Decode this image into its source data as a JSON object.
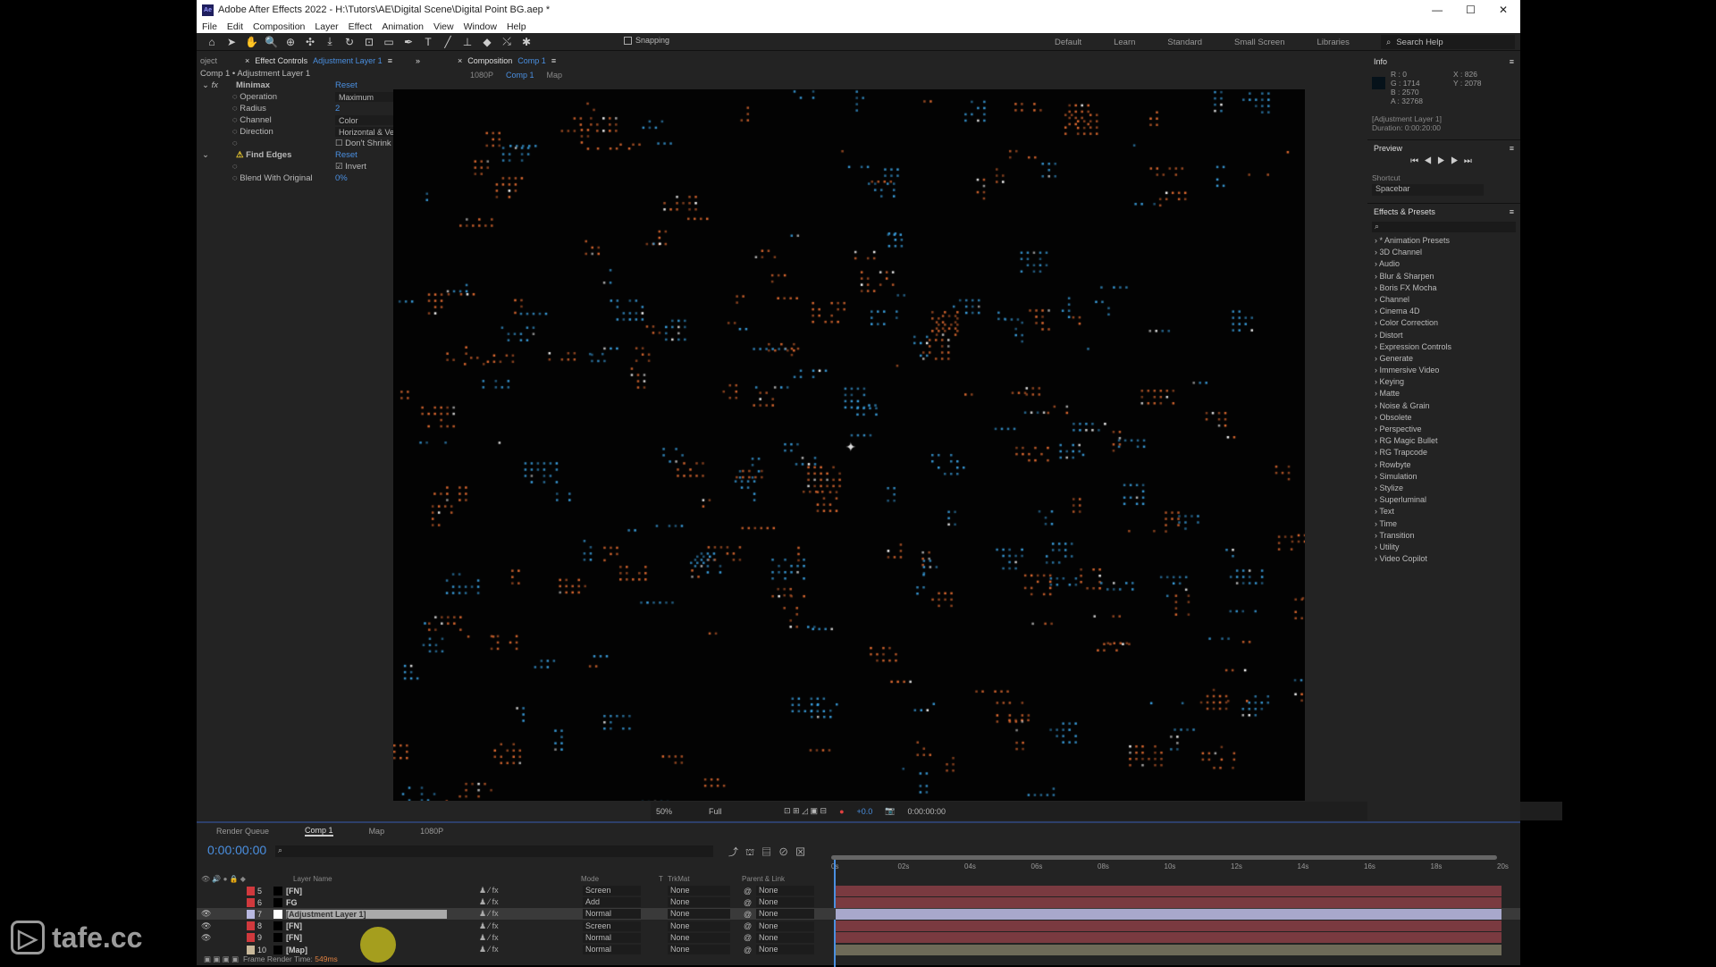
{
  "window": {
    "title": "Adobe After Effects 2022 - H:\\Tutors\\AE\\Digital Scene\\Digital Point BG.aep *",
    "app_icon": "Ae",
    "controls": [
      "—",
      "☐",
      "✕"
    ]
  },
  "menu": [
    "File",
    "Edit",
    "Composition",
    "Layer",
    "Effect",
    "Animation",
    "View",
    "Window",
    "Help"
  ],
  "toolbar": {
    "tools": [
      "⌂",
      "➤",
      "✋",
      "🔍",
      "⊕",
      "✣",
      "⤓",
      "↻",
      "⊡",
      "▭",
      "✒",
      "T",
      "╱",
      "⊥",
      "◆",
      "⤯",
      "✱"
    ],
    "snapping": "Snapping"
  },
  "workspaces": [
    "Default",
    "Learn",
    "Standard",
    "Small Screen",
    "Libraries"
  ],
  "search_help": "Search Help",
  "effect_controls": {
    "project_tab": "oject",
    "tab": "Effect Controls",
    "layer": "Adjustment Layer 1",
    "breadcrumb": "Comp 1 • Adjustment Layer 1",
    "minimax": {
      "name": "Minimax",
      "reset": "Reset",
      "operation_label": "Operation",
      "operation": "Maximum",
      "radius_label": "Radius",
      "radius": "2",
      "channel_label": "Channel",
      "channel": "Color",
      "direction_label": "Direction",
      "direction": "Horizontal & Vertical",
      "dont_shrink": "Don't Shrink Edges",
      "dont_shrink_checked": false
    },
    "find_edges": {
      "name": "Find Edges",
      "reset": "Reset",
      "invert": "Invert",
      "invert_checked": true,
      "blend_label": "Blend With Original",
      "blend": "0%"
    }
  },
  "composition": {
    "tab": "Composition",
    "comp": "Comp 1",
    "crumbs": [
      "1080P",
      "Comp 1",
      "Map"
    ],
    "zoom": "50%",
    "resolution": "Full",
    "exposure": "+0.0",
    "timecode": "0:00:00:00"
  },
  "info": {
    "title": "Info",
    "r": "R : 0",
    "g": "G : 1714",
    "b": "B : 2570",
    "a": "A : 32768",
    "x": "X : 826",
    "y": "Y : 2078",
    "layer": "[Adjustment Layer 1]",
    "duration": "Duration: 0:00:20:00"
  },
  "preview": {
    "title": "Preview",
    "shortcut_label": "Shortcut",
    "shortcut": "Spacebar"
  },
  "effects_presets": {
    "title": "Effects & Presets",
    "items": [
      "* Animation Presets",
      "3D Channel",
      "Audio",
      "Blur & Sharpen",
      "Boris FX Mocha",
      "Channel",
      "Cinema 4D",
      "Color Correction",
      "Distort",
      "Expression Controls",
      "Generate",
      "Immersive Video",
      "Keying",
      "Matte",
      "Noise & Grain",
      "Obsolete",
      "Perspective",
      "RG Magic Bullet",
      "RG Trapcode",
      "Rowbyte",
      "Simulation",
      "Stylize",
      "Superluminal",
      "Text",
      "Time",
      "Transition",
      "Utility",
      "Video Copilot"
    ]
  },
  "timeline": {
    "tabs": [
      "Render Queue",
      "Comp 1",
      "Map",
      "1080P"
    ],
    "timecode": "0:00:00:00",
    "columns": {
      "layer_name": "Layer Name",
      "mode": "Mode",
      "t": "T",
      "trkmat": "TrkMat",
      "parent": "Parent & Link"
    },
    "ruler": [
      "0s",
      "02s",
      "04s",
      "06s",
      "08s",
      "10s",
      "12s",
      "14s",
      "16s",
      "18s",
      "20s"
    ],
    "layers": [
      {
        "num": "5",
        "name": "[FN]",
        "label_color": "#d0393d",
        "mode": "Screen",
        "trkmat": "None",
        "parent": "None",
        "visible": false,
        "bar": "#7a3a40"
      },
      {
        "num": "6",
        "name": "FG",
        "label_color": "#d0393d",
        "mode": "Add",
        "trkmat": "None",
        "parent": "None",
        "visible": false,
        "bar": "#7a3a40"
      },
      {
        "num": "7",
        "name": "[Adjustment Layer 1]",
        "label_color": "#b8b8e0",
        "mode": "Normal",
        "trkmat": "None",
        "parent": "None",
        "visible": true,
        "selected": true,
        "bar": "#a8a8cc"
      },
      {
        "num": "8",
        "name": "[FN]",
        "label_color": "#d0393d",
        "mode": "Screen",
        "trkmat": "None",
        "parent": "None",
        "visible": true,
        "bar": "#7a3a40"
      },
      {
        "num": "9",
        "name": "[FN]",
        "label_color": "#d0393d",
        "mode": "Normal",
        "trkmat": "None",
        "parent": "None",
        "visible": true,
        "bar": "#7a3a40"
      },
      {
        "num": "10",
        "name": "[Map]",
        "label_color": "#c8b89a",
        "mode": "Normal",
        "trkmat": "None",
        "parent": "None",
        "visible": false,
        "bar": "#6e6a58"
      }
    ],
    "render_time_label": "Frame Render Time:",
    "render_time": "549ms"
  },
  "watermark": "tafe.cc",
  "colors": {
    "accent": "#4a8fe0",
    "dot_orange": "#e06a30",
    "dot_blue": "#3aa0e0"
  }
}
